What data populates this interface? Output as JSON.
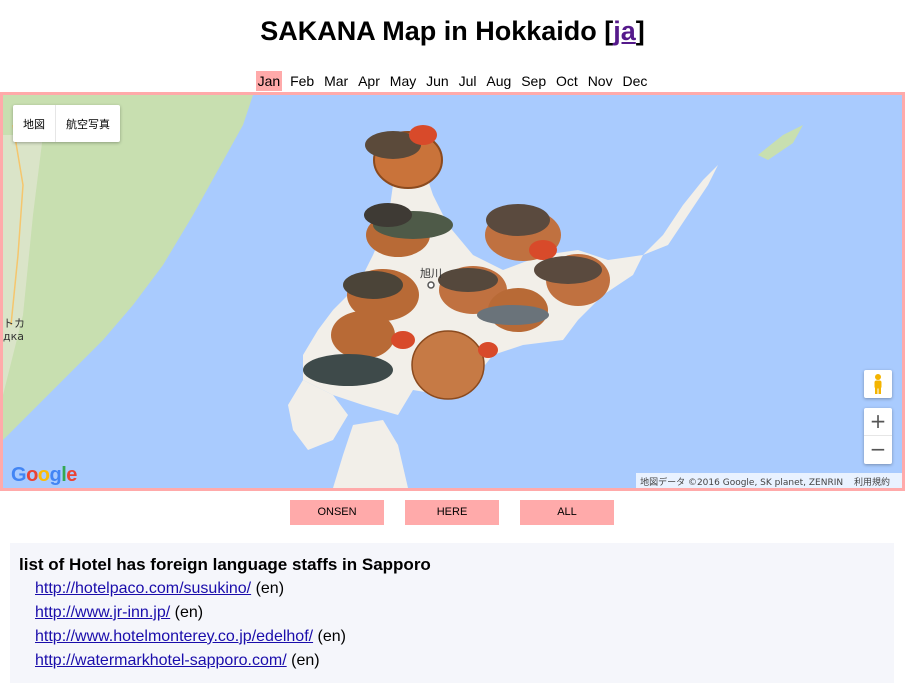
{
  "header": {
    "title": "SAKANA Map in Hokkaido [",
    "lang_link": "ja",
    "title_end": "]"
  },
  "months": [
    "Jan",
    "Feb",
    "Mar",
    "Apr",
    "May",
    "Jun",
    "Jul",
    "Aug",
    "Sep",
    "Oct",
    "Nov",
    "Dec"
  ],
  "active_month": "Jan",
  "map": {
    "maptype_map": "地図",
    "maptype_satellite": "航空写真",
    "city_label": "旭川",
    "edge_label_1": "トカ",
    "edge_label_2": "дка",
    "zoom_in": "+",
    "zoom_out": "−",
    "google_logo": "Google",
    "attribution": "地図データ ©2016 Google, SK planet, ZENRIN",
    "terms": "利用規約",
    "water_color": "#a9cbfe",
    "land_color": "#f2efe9",
    "park_color": "#c8dfb0"
  },
  "buttons": {
    "onsen": "ONSEN",
    "here": "HERE",
    "all": "ALL"
  },
  "hotels": {
    "heading": "list of Hotel has foreign language staffs in Sapporo",
    "items": [
      {
        "url": "http://hotelpaco.com/susukino/",
        "lang": "(en)"
      },
      {
        "url": "http://www.jr-inn.jp/",
        "lang": "(en)"
      },
      {
        "url": "http://www.hotelmonterey.co.jp/edelhof/",
        "lang": "(en)"
      },
      {
        "url": "http://watermarkhotel-sapporo.com/",
        "lang": "(en)"
      }
    ]
  }
}
